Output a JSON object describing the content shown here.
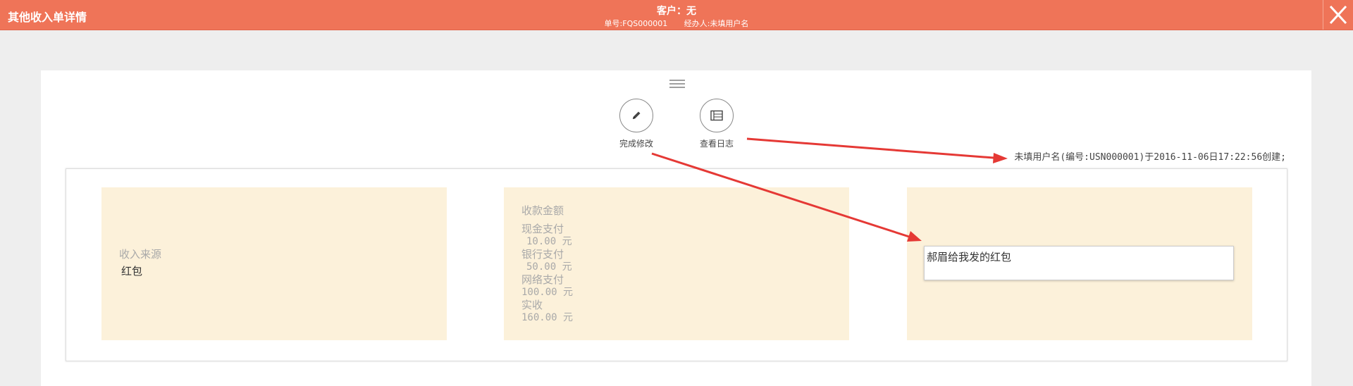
{
  "header": {
    "title": "其他收入单详情",
    "customer": "客户：无",
    "order_no": "单号:FQS000001",
    "handler": "经办人:未填用户名",
    "bg_color": "#ef7458"
  },
  "toolbar": {
    "menu_icon": "hamburger-icon",
    "actions": [
      {
        "label": "完成修改",
        "icon": "pencil-icon"
      },
      {
        "label": "查看日志",
        "icon": "log-table-icon"
      }
    ]
  },
  "creation_info": "未填用户名(编号:USN000001)于2016-11-06日17:22:56创建;",
  "cards": {
    "source": {
      "label": "收入来源",
      "value": "红包"
    },
    "amount": {
      "title": "收款金额",
      "items": [
        {
          "label": "现金支付",
          "value": "10.00 元"
        },
        {
          "label": "银行支付",
          "value": "50.00 元"
        },
        {
          "label": "网络支付",
          "value": "100.00 元"
        },
        {
          "label": "实收",
          "value": "160.00 元"
        }
      ]
    },
    "memo": {
      "value": "郝眉给我发的红包"
    },
    "bg_color": "#fcf1da"
  },
  "annotation_color": "#e53935"
}
